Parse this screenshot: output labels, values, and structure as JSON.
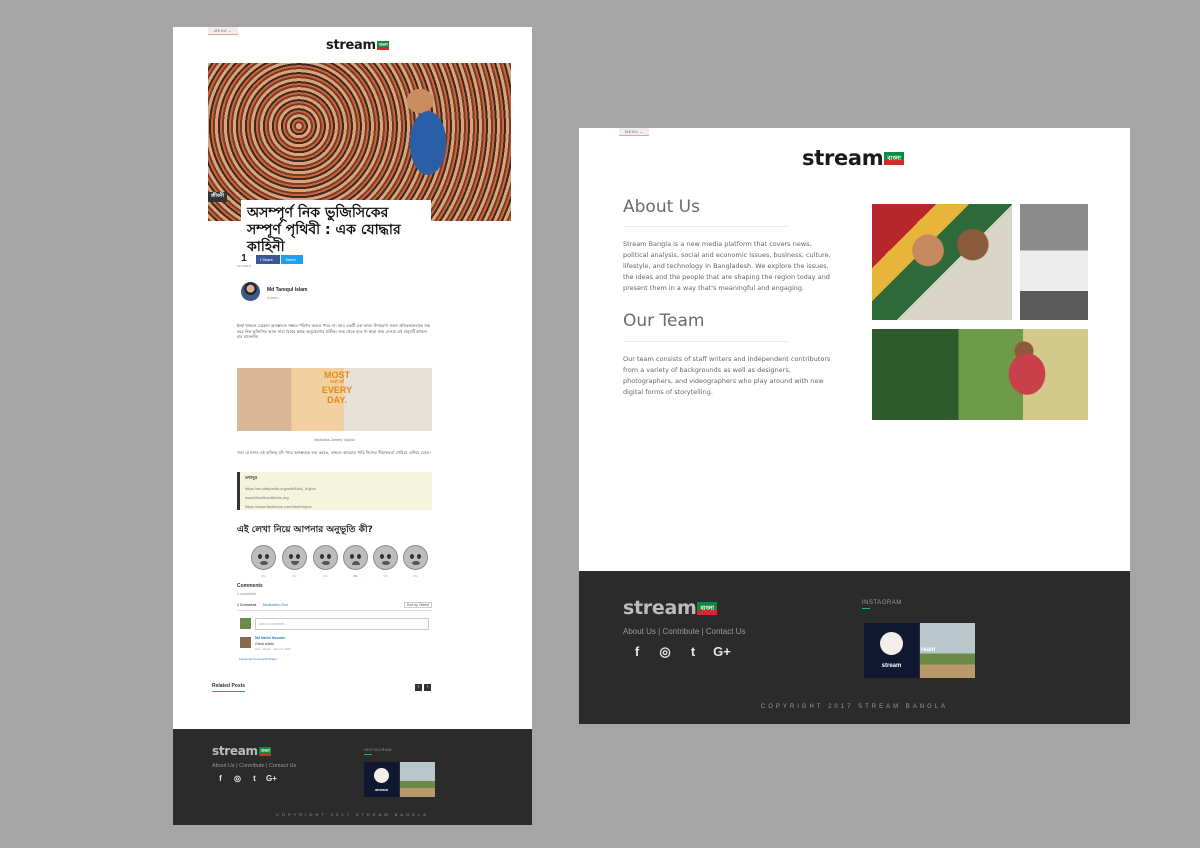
{
  "left_page": {
    "menu_label": "MENU ⌄",
    "logo": {
      "text": "stream",
      "flag": "বাংলা"
    },
    "category": "জীবনী",
    "article_title": "অসম্পূর্ণ নিক ভুজিসিকের সম্পূর্ণ পৃথিবী : এক যোদ্ধার কাহিনী",
    "share_count": "1",
    "share_label": "SHARES",
    "share_facebook": "f Share",
    "share_twitter": "Tweet",
    "author_name": "Md Tarequl Islam",
    "author_role": "Admin",
    "body_paragraph_1": "ইচ্ছা থাকলে যেকোন অসম্ভবকে সম্ভবে পরিণত করতে পারে না। আর একটি এক অদম্য উদাহরণ। সকল প্রতিবন্ধকতাকে জয় করে নিক ভুজিসিক আজ সারা বিশ্বের কাছে অনুপ্রেরণার প্রতীক। জন্ম থেকে হাত পা ছাড়া জন্ম নেওয়া এই মানুষটি কখনো হার মানেননি।",
    "inline_image_text": [
      "MOST",
      "out of",
      "EVERY",
      "DAY."
    ],
    "image_caption": "Nicholas James Vujicic",
    "body_paragraph_2": "সত্য যে মানব এই ব্যক্তিত্ব যদি পারে অসম্ভবকে জয় করতে, তাহলে আমরাও পারি নিজের সীমাবদ্ধতা পেরিয়ে এগিয়ে যেতে।",
    "sources": {
      "heading": "তথ্যসূত্র",
      "links": [
        "https://en.wikipedia.org/wiki/Nick_Vujicic",
        "www.lifewithoutlimbs.org",
        "https://www.facebook.com/NickVujicic"
      ]
    },
    "reactions_title": "এই লেখা নিয়ে আপনার অনুভূতি কী?",
    "reactions": [
      {
        "icon": "surprised-face-icon",
        "pct": "0%"
      },
      {
        "icon": "smile-face-icon",
        "pct": "0%"
      },
      {
        "icon": "crying-face-icon",
        "pct": "0%"
      },
      {
        "icon": "sad-face-icon",
        "pct": "0%"
      },
      {
        "icon": "sleepy-face-icon",
        "pct": "0%"
      },
      {
        "icon": "dizzy-face-icon",
        "pct": "0%"
      }
    ],
    "comments": {
      "title": "Comments",
      "count": "1 comments",
      "tab_comments": "1 Comment",
      "tab_plugin": "Moderation Tool",
      "sort_label": "Sort by",
      "sort_value": "Oldest",
      "input_placeholder": "Add a comment...",
      "commenter": "Md Nahid Hossain",
      "comment_text": "Great article",
      "comment_meta": "Like · Reply · Jan 14, 2017",
      "plugin_label": "Facebook Comments Plugin"
    },
    "related_posts": "Related Posts",
    "footer": {
      "logo": "stream",
      "logo_flag": "বাংলা",
      "links": [
        "About Us",
        "Contribute",
        "Contact Us"
      ],
      "instagram_label": "INSTAGRAM",
      "ig_thumb_label": "stream",
      "copyright": "COPYRIGHT 2017 STREAM BANGLA"
    }
  },
  "right_page": {
    "menu_label": "MENU ⌄",
    "logo": {
      "text": "stream",
      "flag": "বাংলা"
    },
    "about_heading": "About Us",
    "about_text": "Stream Bangla is a new media platform that covers news, political analysis, social and economic issues, business, culture, lifestyle, and technology in Bangladesh. We explore the issues, the ideas and the people that are shaping the region today and present them in a way that's meaningful and engaging.",
    "team_heading": "Our Team",
    "team_text": "Our team consists of staff writers and independent contributors from a variety of backgrounds as well as designers, photographers, and videographers who play around with new digital forms of storytelling.",
    "footer": {
      "logo": "stream",
      "logo_flag": "বাংলা",
      "links": [
        "About Us",
        "Contribute",
        "Contact Us"
      ],
      "instagram_label": "INSTAGRAM",
      "ig_thumb_label": "stream",
      "ig_thumb2_label": "ream",
      "copyright": "COPYRIGHT 2017 STREAM BANGLA"
    }
  },
  "social_icons": [
    "facebook-icon",
    "instagram-icon",
    "twitter-icon",
    "google-plus-icon"
  ],
  "colors": {
    "background": "#a5a5a5",
    "footer": "#2b2b2b",
    "accent": "#1cb37a",
    "facebook": "#3b5998",
    "twitter": "#1da1f2"
  }
}
